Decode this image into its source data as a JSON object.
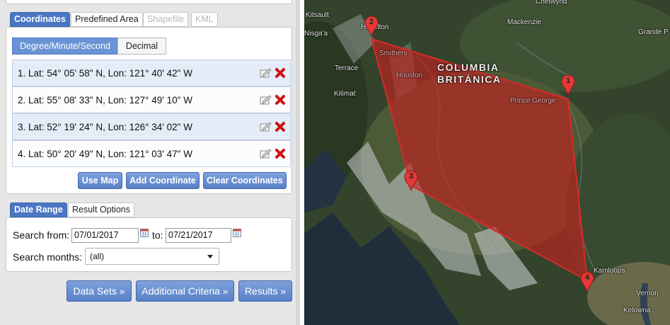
{
  "tabs": {
    "coordinates": "Coordinates",
    "predefined_area": "Predefined Area",
    "shapefile": "Shapefile",
    "kml": "KML"
  },
  "format_toggle": {
    "dms": "Degree/Minute/Second",
    "decimal": "Decimal"
  },
  "coordinates": [
    {
      "label": "1.  Lat: 54° 05' 58\" N, Lon: 121° 40' 42\" W"
    },
    {
      "label": "2.  Lat: 55° 08' 33\" N, Lon: 127° 49' 10\" W"
    },
    {
      "label": "3.  Lat: 52° 19' 24\" N, Lon: 126° 34' 02\" W"
    },
    {
      "label": "4.  Lat: 50° 20' 49\" N, Lon: 121° 03' 47\" W"
    }
  ],
  "coord_buttons": {
    "use_map": "Use Map",
    "add_coordinate": "Add Coordinate",
    "clear_coordinates": "Clear Coordinates"
  },
  "date_tabs": {
    "date_range": "Date Range",
    "result_options": "Result Options"
  },
  "date_range": {
    "search_from_label": "Search from:",
    "from_value": "07/01/2017",
    "to_label": "to:",
    "to_value": "07/21/2017",
    "months_label": "Search months:",
    "months_value": "(all)"
  },
  "nav_buttons": {
    "data_sets": "Data Sets »",
    "additional_criteria": "Additional Criteria »",
    "results": "Results »"
  },
  "map": {
    "region_label_line1": "COLUMBIA",
    "region_label_line2": "BRITÁNICA",
    "places": [
      {
        "id": "kitsault",
        "name": "Kitsault"
      },
      {
        "id": "nisgaa",
        "name": "Nisga'a"
      },
      {
        "id": "hazelton",
        "name": "Hazelton"
      },
      {
        "id": "smithers",
        "name": "Smithers"
      },
      {
        "id": "houston",
        "name": "Houston"
      },
      {
        "id": "terrace",
        "name": "Terrace"
      },
      {
        "id": "kitimat",
        "name": "Kitimat"
      },
      {
        "id": "chetwynd",
        "name": "Chetwynd"
      },
      {
        "id": "mackenzie",
        "name": "Mackenzie"
      },
      {
        "id": "grande-prairie",
        "name": "Grande P"
      },
      {
        "id": "prince-george",
        "name": "Prince George"
      },
      {
        "id": "kamloops",
        "name": "Kamloops"
      },
      {
        "id": "vernon",
        "name": "Vernon"
      },
      {
        "id": "kelowna",
        "name": "Kelowna"
      }
    ],
    "markers": [
      "1",
      "2",
      "3",
      "4"
    ],
    "polygon_color": "#c81e1e",
    "marker_color": "#e53935"
  }
}
